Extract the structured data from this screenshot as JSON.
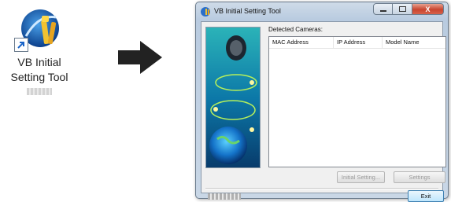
{
  "desktop_shortcut": {
    "label_line1": "VB Initial",
    "label_line2": "Setting Tool",
    "icon": "vb-tool-app-icon"
  },
  "flow_arrow": {
    "icon": "right-arrow-icon"
  },
  "window": {
    "title": "VB Initial Setting Tool",
    "controls": {
      "minimize_icon": "minimize-icon",
      "maximize_icon": "maximize-icon",
      "close_label": "X"
    },
    "detected_label": "Detected Cameras:",
    "list_columns": [
      "MAC Address",
      "IP Address",
      "Model Name"
    ],
    "initial_setting_label": "Initial Setting...",
    "settings_label": "Settings",
    "exit_label": "Exit"
  },
  "colors": {
    "titlebar": "#b9cbe0",
    "close_button": "#c8452f",
    "arrow": "#222222"
  }
}
